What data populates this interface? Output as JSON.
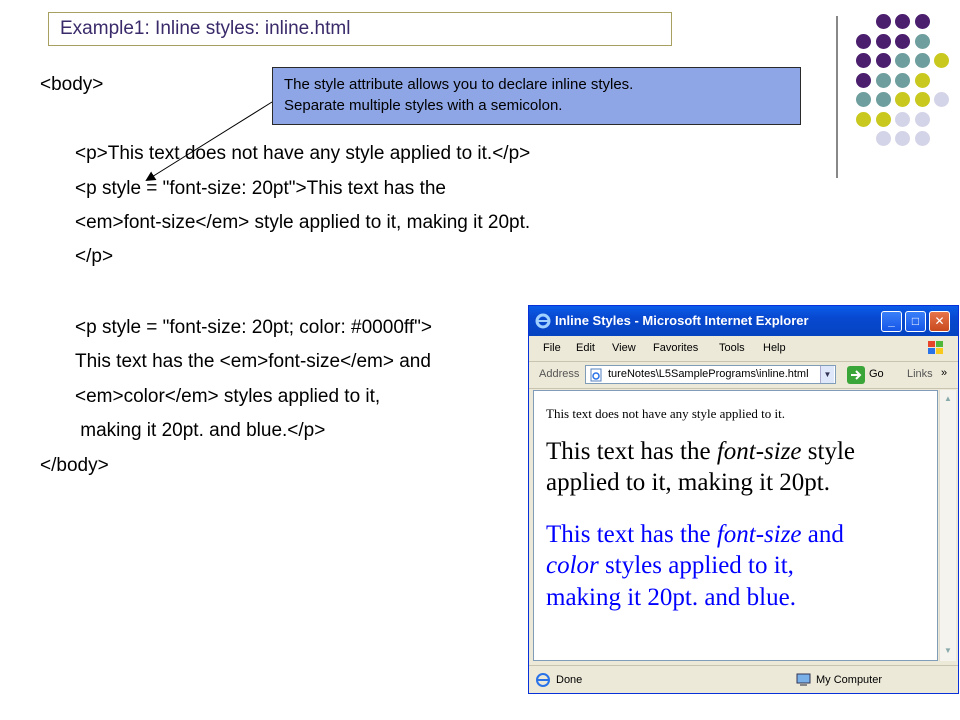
{
  "slide": {
    "title": "Example1: Inline styles: inline.html",
    "code_lines": [
      "<body>",
      "<p>This text does not have any style applied to it.</p>",
      "<p style = \"font-size: 20pt\">This text has the",
      "<em>font-size</em> style applied to it, making it 20pt.",
      "</p>",
      "<p style = \"font-size: 20pt; color: #0000ff\">",
      "This text has the <em>font-size</em> and",
      "<em>color</em> styles applied to it,",
      " making it 20pt. and blue.</p>",
      "</body>"
    ],
    "callout": {
      "line1": "The style attribute allows you to declare inline styles.",
      "line2": "Separate multiple styles with a semicolon."
    },
    "dot_colors": {
      "purple": "#4b1e6e",
      "teal": "#6f9e9e",
      "yellow": "#c8c81e",
      "lavender": "#d4d4e8"
    }
  },
  "browser": {
    "title": "Inline Styles - Microsoft Internet Explorer",
    "menu": [
      "File",
      "Edit",
      "View",
      "Favorites",
      "Tools",
      "Help"
    ],
    "address_label": "Address",
    "address_value": "tureNotes\\L5SamplePrograms\\inline.html",
    "go_label": "Go",
    "links_label": "Links",
    "content": {
      "p1": "This text does not have any style applied to it.",
      "p2_a": "This text has the ",
      "p2_em": "font-size",
      "p2_b": " style",
      "p2_line2": "applied to it, making it 20pt.",
      "p3_a": "This text has the ",
      "p3_em1": "font-size",
      "p3_b": " and",
      "p3_em2": "color",
      "p3_c": " styles applied to it,",
      "p3_line3": "making it 20pt. and blue.",
      "blue": "#0000ff"
    },
    "status_left": "Done",
    "status_right": "My Computer"
  }
}
